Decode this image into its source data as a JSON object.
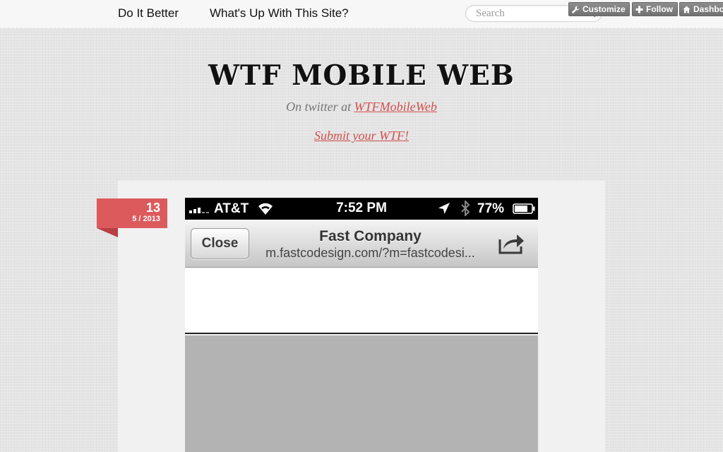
{
  "nav": {
    "links": [
      "Do It Better",
      "What's Up With This Site?"
    ],
    "search_placeholder": "Search"
  },
  "tumblr_controls": {
    "customize": "Customize",
    "follow": "Follow",
    "dashboard": "Dashbo"
  },
  "header": {
    "title": "WTF MOBILE WEB",
    "twitter_prefix": "On twitter at",
    "twitter_handle": "WTFMobileWeb",
    "submit": "Submit your WTF!"
  },
  "post": {
    "date_day": "13",
    "date_month": "5 / 2013",
    "screenshot": {
      "carrier": "AT&T",
      "time": "7:52 PM",
      "battery": "77%",
      "close_label": "Close",
      "page_title": "Fast Company",
      "page_url": "m.fastcodesign.com/?m=fastcodesi..."
    }
  },
  "colors": {
    "accent": "#d2504f",
    "ribbon": "#dc5a5c",
    "background": "#e4e4e4"
  }
}
